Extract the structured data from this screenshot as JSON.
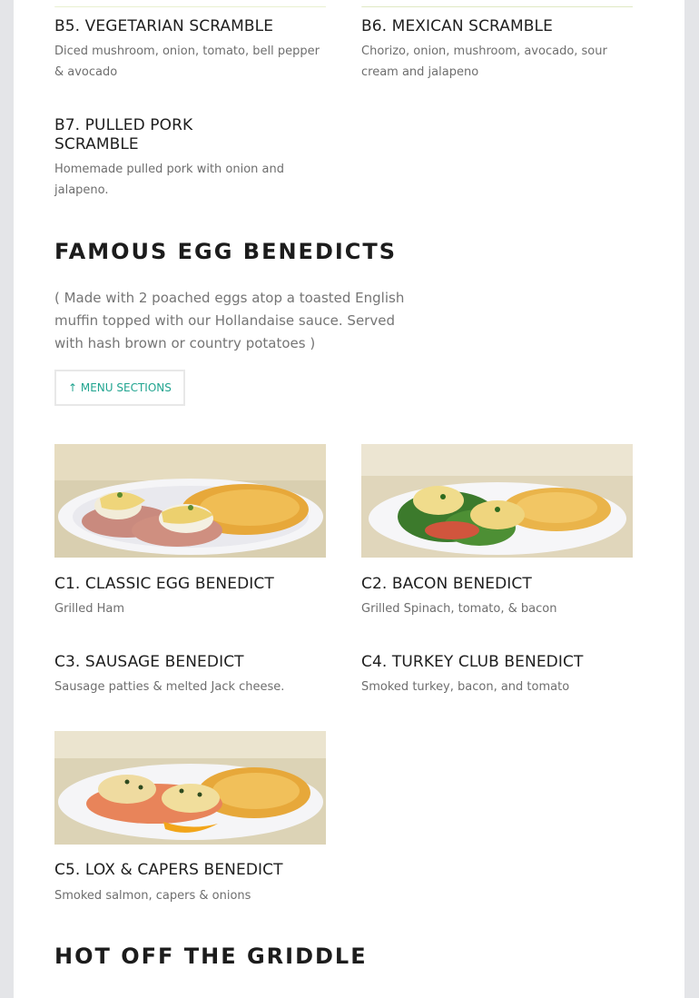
{
  "scramble_items": [
    {
      "title": "B5. VEGETARIAN SCRAMBLE",
      "desc": "Diced mushroom, onion, tomato, bell pepper & avocado"
    },
    {
      "title": "B6. MEXICAN SCRAMBLE",
      "desc": "Chorizo, onion, mushroom, avocado, sour cream and jalapeno"
    },
    {
      "title": "B7. PULLED PORK SCRAMBLE",
      "desc": "Homemade pulled pork with onion and jalapeno."
    }
  ],
  "benedicts": {
    "title": "FAMOUS EGG BENEDICTS",
    "note": "( Made with 2 poached eggs atop a toasted English muffin topped with our Hollandaise sauce. Served with hash brown or country potatoes )",
    "menu_button": "↑ MENU SECTIONS",
    "items": [
      {
        "title": "C1. CLASSIC EGG BENEDICT",
        "desc": "Grilled Ham"
      },
      {
        "title": "C2. BACON BENEDICT",
        "desc": "Grilled Spinach, tomato, & bacon"
      },
      {
        "title": "C3. SAUSAGE BENEDICT",
        "desc": "Sausage patties & melted Jack cheese."
      },
      {
        "title": "C4. TURKEY CLUB BENEDICT",
        "desc": "Smoked turkey, bacon, and tomato"
      },
      {
        "title": "C5. LOX & CAPERS BENEDICT",
        "desc": "Smoked salmon, capers & onions"
      }
    ]
  },
  "griddle": {
    "title": "HOT OFF THE GRIDDLE"
  },
  "colors": {
    "accent": "#20a48f",
    "background": "#e4e5e8",
    "card": "#ffffff"
  }
}
